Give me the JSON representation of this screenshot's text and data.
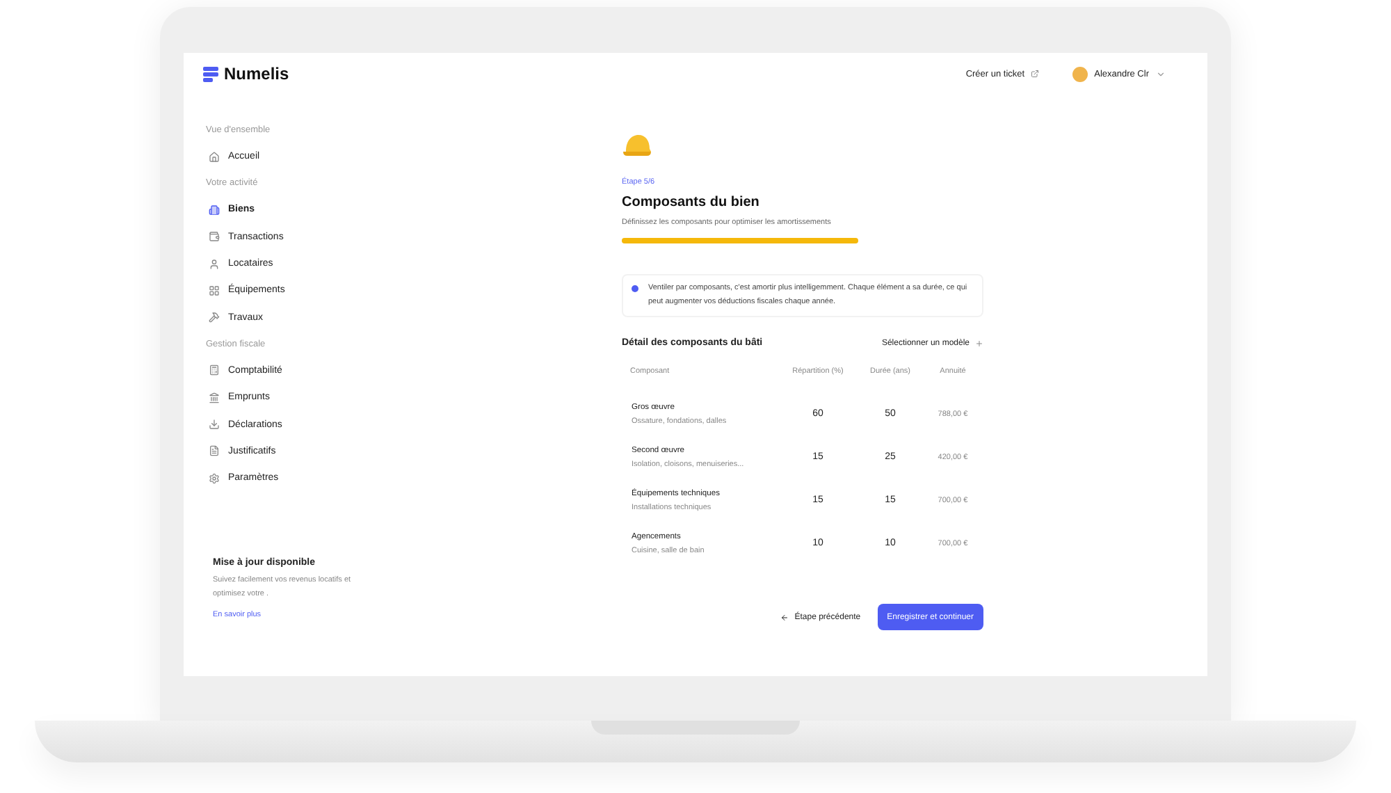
{
  "header": {
    "brand": "Numelis",
    "ticket_link": "Créer un ticket",
    "user_name": "Alexandre Clr"
  },
  "sidebar": {
    "sections": [
      {
        "title": "Vue d'ensemble",
        "items": [
          {
            "label": "Accueil",
            "selected": false
          }
        ]
      },
      {
        "title": "Votre activité",
        "items": [
          {
            "label": "Biens",
            "selected": true
          },
          {
            "label": "Transactions",
            "selected": false
          },
          {
            "label": "Locataires",
            "selected": false
          },
          {
            "label": "Équipements",
            "selected": false
          },
          {
            "label": "Travaux",
            "selected": false
          }
        ]
      },
      {
        "title": "Gestion fiscale",
        "items": [
          {
            "label": "Comptabilité",
            "selected": false
          },
          {
            "label": "Emprunts",
            "selected": false
          },
          {
            "label": "Déclarations",
            "selected": false
          },
          {
            "label": "Justificatifs",
            "selected": false
          },
          {
            "label": "Paramètres",
            "selected": false
          }
        ]
      }
    ],
    "update": {
      "title": "Mise à jour disponible",
      "text": "Suivez facilement vos revenus locatifs et optimisez votre .",
      "link": "En savoir plus"
    }
  },
  "step": {
    "label": "Étape 5/6",
    "title": "Composants du bien",
    "subtitle": "Définissez les composants pour optimiser les amortissements",
    "level": 1
  },
  "info": "Ventiler par composants, c'est amortir plus intelligemment. Chaque élément a sa durée, ce qui peut augmenter vos déductions fiscales chaque année.",
  "section": {
    "title": "Détail des composants du bâti",
    "action": "Sélectionner un modèle"
  },
  "table": {
    "columns": [
      "Composant",
      "Répartition (%)",
      "Durée (ans)",
      "Annuité"
    ],
    "rows": [
      {
        "name": "Gros œuvre",
        "detail": "Ossature, fondations, dalles",
        "share": "60",
        "duration": "50",
        "annuity": "788,00 €"
      },
      {
        "name": "Second œuvre",
        "detail": "Isolation, cloisons, menuiseries...",
        "share": "15",
        "duration": "25",
        "annuity": "420,00 €"
      },
      {
        "name": "Équipements techniques",
        "detail": "Installations techniques",
        "share": "15",
        "duration": "15",
        "annuity": "700,00 €"
      },
      {
        "name": "Agencements",
        "detail": "Cuisine, salle de bain",
        "share": "10",
        "duration": "10",
        "annuity": "700,00 €"
      }
    ]
  },
  "buttons": {
    "back": "Étape précédente",
    "next": "Enregistrer et continuer"
  }
}
